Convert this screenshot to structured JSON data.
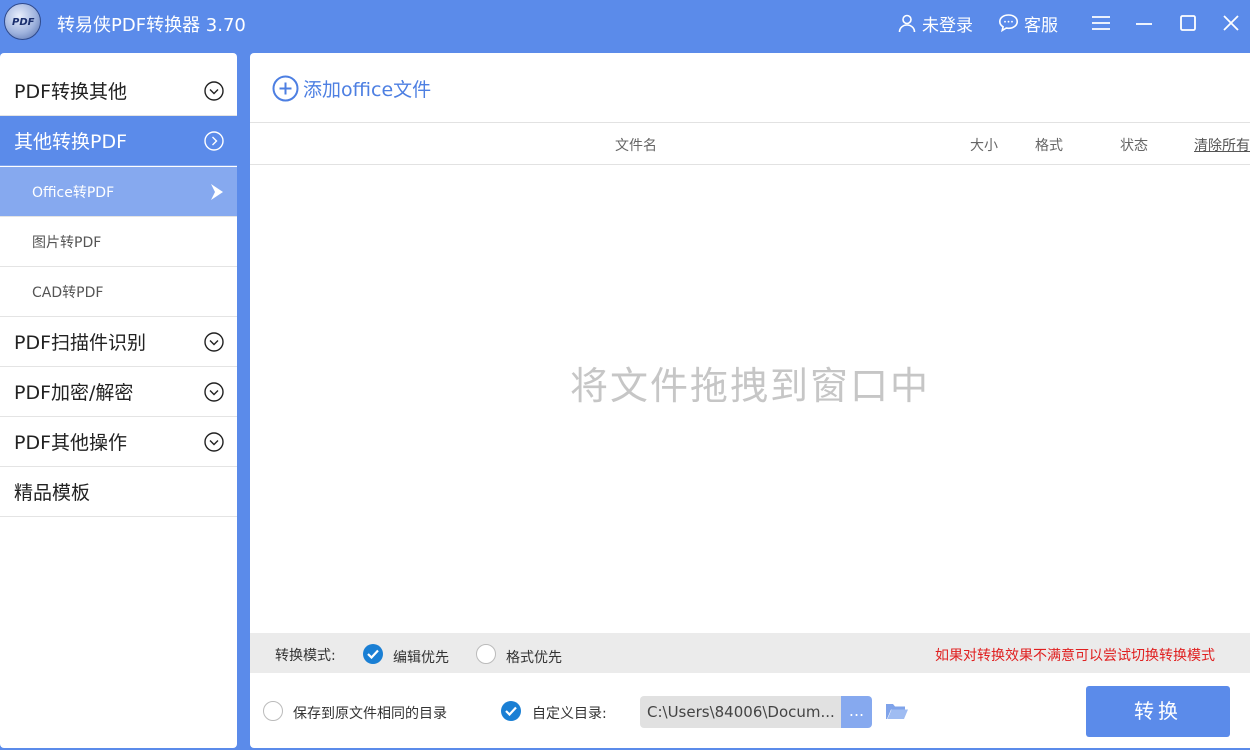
{
  "app": {
    "title": "转易侠PDF转换器 3.70",
    "logo_text": "PDF",
    "login_label": "未登录",
    "service_label": "客服"
  },
  "sidebar": {
    "items": [
      {
        "label": "PDF转换其他"
      },
      {
        "label": "其他转换PDF"
      },
      {
        "label": "Office转PDF"
      },
      {
        "label": "图片转PDF"
      },
      {
        "label": "CAD转PDF"
      },
      {
        "label": "PDF扫描件识别"
      },
      {
        "label": "PDF加密/解密"
      },
      {
        "label": "PDF其他操作"
      },
      {
        "label": "精品模板"
      }
    ]
  },
  "main": {
    "add_file_label": "添加office文件",
    "columns": {
      "name": "文件名",
      "size": "大小",
      "format": "格式",
      "status": "状态",
      "clear": "清除所有"
    },
    "drop_hint": "将文件拖拽到窗口中",
    "mode": {
      "label": "转换模式:",
      "option_edit": "编辑优先",
      "option_format": "格式优先",
      "tip": "如果对转换效果不满意可以尝试切换转换模式"
    },
    "output": {
      "same_dir_label": "保存到原文件相同的目录",
      "custom_dir_label": "自定义目录:",
      "path_value": "C:\\Users\\84006\\Docum...",
      "browse_label": "...",
      "convert_label": "转换"
    }
  },
  "colors": {
    "accent": "#5b8bea",
    "accent_light": "#86a9ef",
    "check_blue": "#1a7fd4",
    "tip_red": "#e02020"
  },
  "state": {
    "selected_mode": "编辑优先",
    "output_choice": "自定义目录"
  }
}
